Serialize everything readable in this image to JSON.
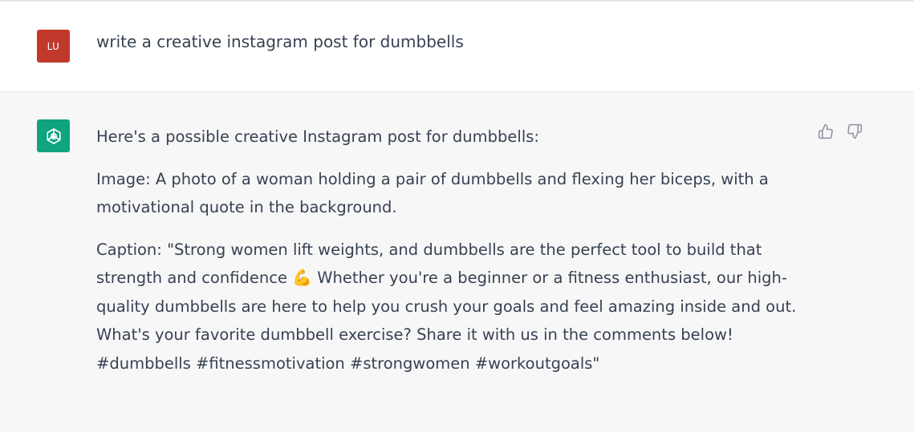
{
  "colors": {
    "user_avatar_bg": "#c0392b",
    "assistant_avatar_bg": "#10a37f",
    "text": "#374151",
    "assistant_bg": "#f7f7f8"
  },
  "user": {
    "avatar_initials": "LU",
    "message": "write a creative instagram post for dumbbells"
  },
  "assistant": {
    "avatar_icon": "openai-logo-icon",
    "intro": "Here's a possible creative Instagram post for dumbbells:",
    "image_line": "Image: A photo of a woman holding a pair of dumbbells and flexing her biceps, with a motivational quote in the background.",
    "caption_part1": "Caption: \"Strong women lift weights, and dumbbells are the perfect tool to build that strength and confidence",
    "caption_emoji": "💪",
    "caption_part2": " Whether you're a beginner or a fitness enthusiast, our high-quality dumbbells are here to help you crush your goals and feel amazing inside and out. What's your favorite dumbbell exercise? Share it with us in the comments below! #dumbbells #fitnessmotivation #strongwomen #workoutgoals\""
  },
  "feedback": {
    "thumbs_up_icon": "thumbs-up-icon",
    "thumbs_down_icon": "thumbs-down-icon"
  }
}
